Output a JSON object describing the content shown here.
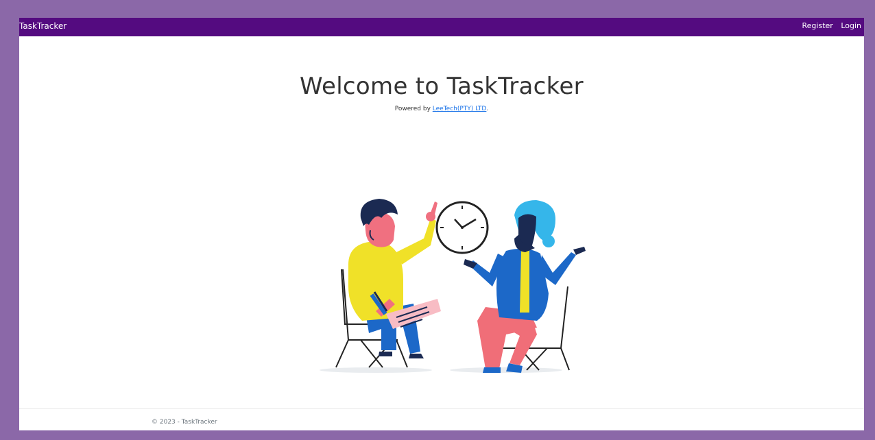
{
  "navbar": {
    "brand": "TaskTracker",
    "links": [
      "Register",
      "Login"
    ]
  },
  "hero": {
    "title": "Welcome to TaskTracker",
    "powered_prefix": "Powered by ",
    "company_link": "LeeTech(PTY) LTD",
    "powered_suffix": "."
  },
  "illustration": {
    "icon": "meeting-illustration",
    "clock_icon": "clock-icon"
  },
  "footer": {
    "text": "© 2023 - TaskTracker"
  },
  "colors": {
    "navbar": "#540b80",
    "border": "#8b68a8",
    "link": "#1a73e8"
  }
}
